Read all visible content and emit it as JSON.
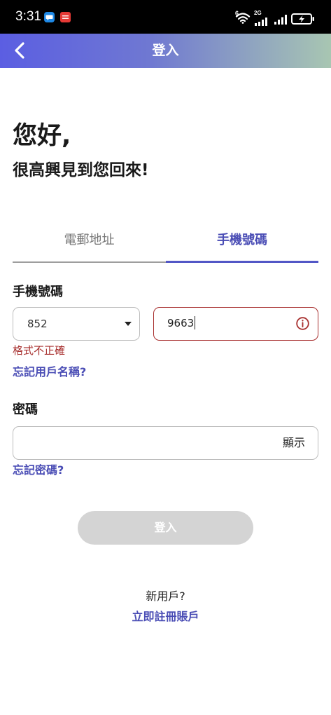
{
  "status_bar": {
    "time": "3:31",
    "wifi_badge": "6",
    "network_type": "2G",
    "icons": [
      "chat-notification-icon",
      "app-notification-icon",
      "wifi-icon",
      "signal-icon",
      "signal-icon",
      "battery-charging-icon"
    ]
  },
  "header": {
    "back_icon": "chevron-left-icon",
    "title": "登入"
  },
  "greeting": {
    "title": "您好,",
    "subtitle": "很高興見到您回來!"
  },
  "tabs": [
    {
      "label": "電郵地址",
      "active": false
    },
    {
      "label": "手機號碼",
      "active": true
    }
  ],
  "phone": {
    "label": "手機號碼",
    "country_code": "852",
    "value": "9663",
    "error": "格式不正確",
    "error_icon": "info-icon"
  },
  "forgot_username": "忘記用戶名稱?",
  "password": {
    "label": "密碼",
    "toggle_label": "顯示"
  },
  "forgot_password": "忘記密碼?",
  "login_button": {
    "label": "登入",
    "enabled": false
  },
  "register": {
    "prompt": "新用戶?",
    "link": "立即註冊賬戶"
  },
  "colors": {
    "accent": "#4a4db5",
    "accent_line": "#5257c6",
    "error": "#a8302f",
    "header_gradient_start": "#5b5ee2",
    "header_gradient_end": "#a8c6b2",
    "disabled_button": "#d4d4d4",
    "status_bar": "#000000"
  }
}
